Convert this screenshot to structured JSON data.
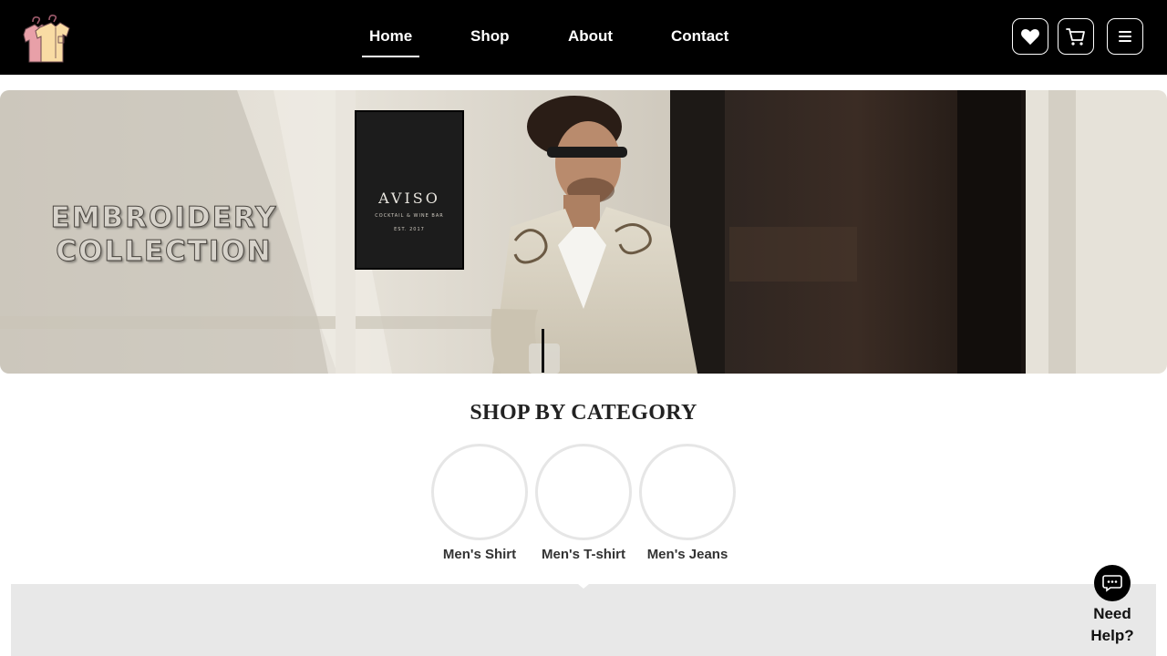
{
  "header": {
    "nav": [
      {
        "label": "Home",
        "active": true
      },
      {
        "label": "Shop",
        "active": false
      },
      {
        "label": "About",
        "active": false
      },
      {
        "label": "Contact",
        "active": false
      }
    ],
    "icons": [
      "heart-icon",
      "cart-icon",
      "menu-icon"
    ]
  },
  "hero": {
    "headline_line1": "EMBROIDERY",
    "headline_line2": "COLLECTION",
    "sign_name": "AVISO",
    "sign_subtitle": "COCKTAIL & WINE BAR",
    "sign_est": "EST. 2017"
  },
  "categories": {
    "title": "SHOP BY CATEGORY",
    "items": [
      {
        "label": "Men's Shirt"
      },
      {
        "label": "Men's T-shirt"
      },
      {
        "label": "Men's Jeans"
      }
    ]
  },
  "help": {
    "label_line1": "Need",
    "label_line2": "Help?"
  },
  "colors": {
    "header_bg": "#000000",
    "panel_bg": "#e8e8e8",
    "accent": "#ffffff"
  }
}
